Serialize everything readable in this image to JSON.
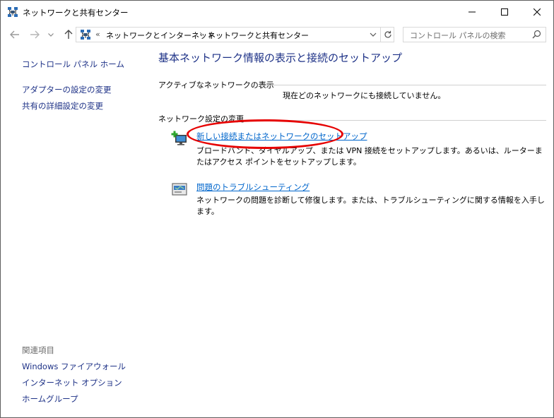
{
  "window": {
    "title": "ネットワークと共有センター"
  },
  "address": {
    "overflow": "«",
    "crumbs": [
      "ネットワークとインターネット",
      "ネットワークと共有センター"
    ],
    "separator": "›"
  },
  "search": {
    "placeholder": "コントロール パネルの検索"
  },
  "sidebar": {
    "home": "コントロール パネル ホーム",
    "links": [
      "アダプターの設定の変更",
      "共有の詳細設定の変更"
    ],
    "related_heading": "関連項目",
    "related": [
      "Windows ファイアウォール",
      "インターネット オプション",
      "ホームグループ"
    ]
  },
  "main": {
    "title": "基本ネットワーク情報の表示と接続のセットアップ",
    "active_label": "アクティブなネットワークの表示",
    "status": "現在どのネットワークにも接続していません。",
    "settings_label": "ネットワーク設定の変更",
    "tasks": [
      {
        "link": "新しい接続またはネットワークのセットアップ",
        "desc": "ブロードバンド、ダイヤルアップ、または VPN 接続をセットアップします。あるいは、ルーターまたはアクセス ポイントをセットアップします。",
        "icon": "new-connection-icon"
      },
      {
        "link": "問題のトラブルシューティング",
        "desc": "ネットワークの問題を診断して修復します。または、トラブルシューティングに関する情報を入手します。",
        "icon": "troubleshoot-icon"
      }
    ]
  },
  "colors": {
    "link": "#0066cc",
    "nav_link": "#1e3287",
    "highlight": "#e60000"
  }
}
